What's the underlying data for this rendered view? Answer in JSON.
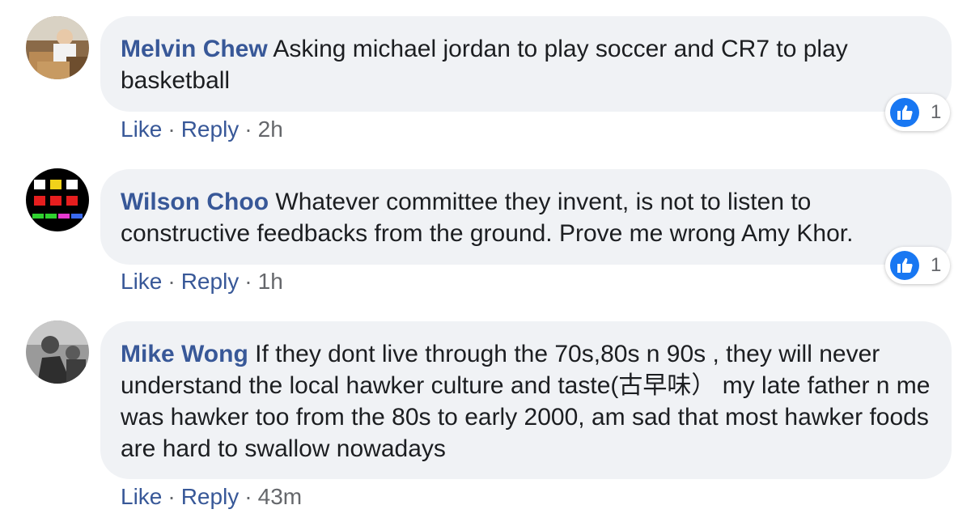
{
  "colors": {
    "author_link": "#385898",
    "bubble_bg": "#f0f2f5",
    "like_blue": "#1877f2",
    "meta_gray": "#65676b"
  },
  "labels": {
    "like": "Like",
    "reply": "Reply",
    "separator": "·"
  },
  "comments": [
    {
      "author": "Melvin Chew",
      "text": "Asking michael jordan to play soccer and CR7 to play basketball",
      "time": "2h",
      "reaction_icon": "thumbs-up-icon",
      "reaction_count": "1"
    },
    {
      "author": "Wilson Choo",
      "text": "Whatever committee they invent, is not to listen to constructive feedbacks from the ground. Prove me wrong Amy Khor.",
      "time": "1h",
      "reaction_icon": "thumbs-up-icon",
      "reaction_count": "1"
    },
    {
      "author": "Mike Wong",
      "text": "If they dont live through the 70s,80s n 90s , they will never understand the local hawker culture and taste(古早味） my late father n me was hawker too from the 80s to early 2000, am sad that most hawker foods are hard to swallow nowadays",
      "time": "43m"
    }
  ]
}
